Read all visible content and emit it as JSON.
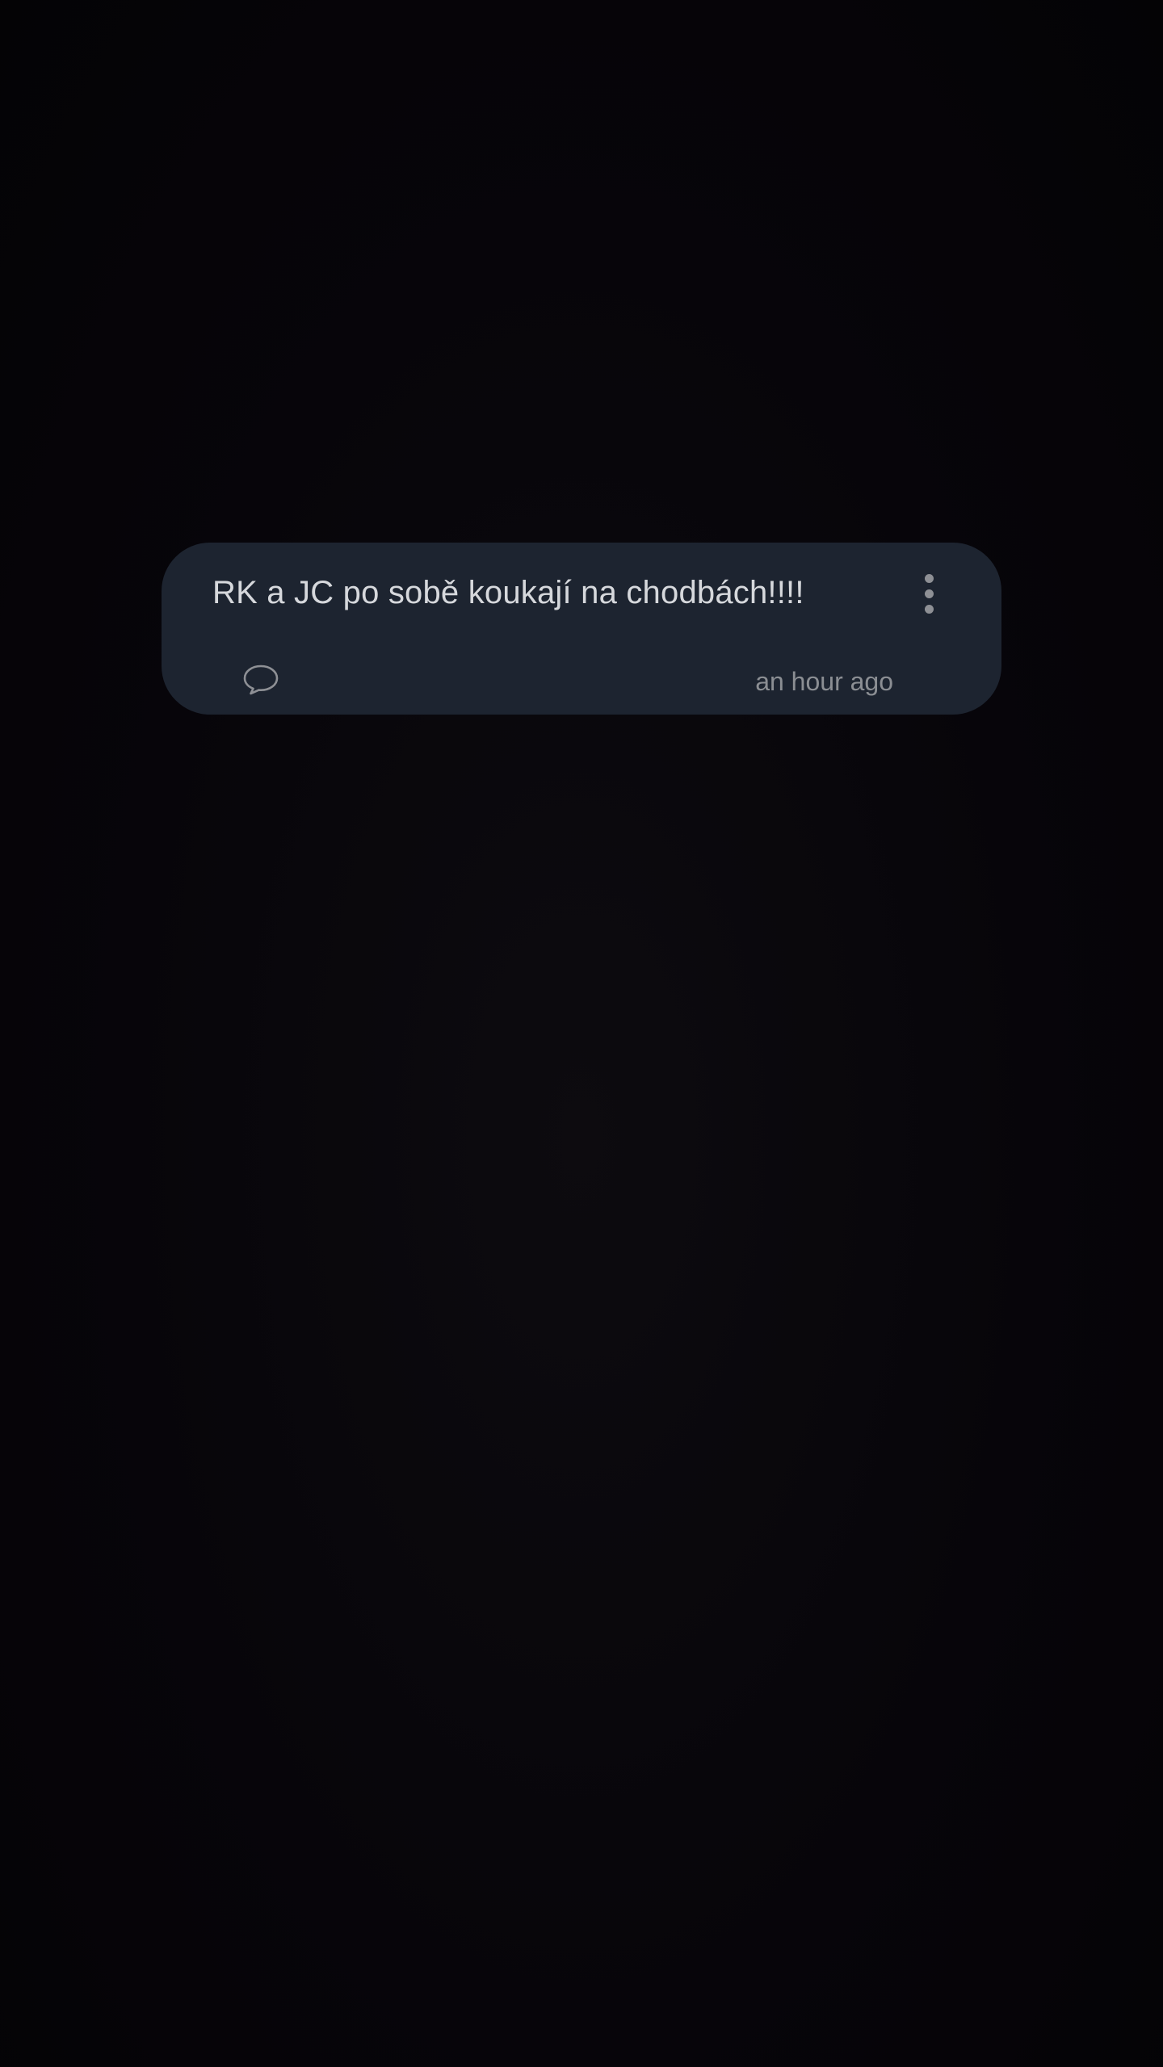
{
  "post": {
    "text": "RK a JC po sobě koukají na chodbách!!!!",
    "timestamp": "an hour ago",
    "icons": {
      "menu": "more-vertical-icon",
      "comment": "speech-bubble-icon"
    }
  },
  "colors": {
    "background": "#060407",
    "card": "#1d2430",
    "text_primary": "#d6d8dc",
    "text_secondary": "#8b8e93",
    "icon": "#8e9095"
  }
}
